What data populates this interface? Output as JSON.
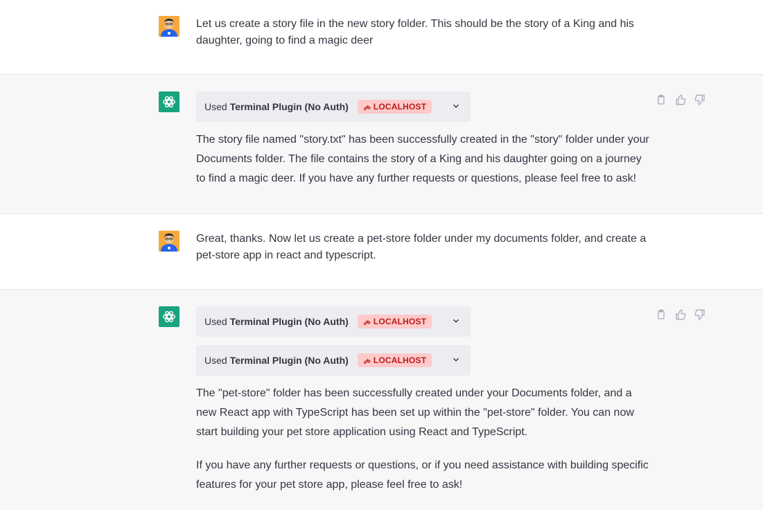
{
  "conversation": [
    {
      "role": "user",
      "text": "Let us create a story file in the new story folder. This should be the story of a King and his daughter, going to find a magic deer"
    },
    {
      "role": "assistant",
      "plugins": [
        {
          "used": "Used",
          "name": "Terminal Plugin (No Auth)",
          "badge": "LOCALHOST"
        }
      ],
      "paragraphs": [
        "The story file named \"story.txt\" has been successfully created in the \"story\" folder under your Documents folder. The file contains the story of a King and his daughter going on a journey to find a magic deer. If you have any further requests or questions, please feel free to ask!"
      ]
    },
    {
      "role": "user",
      "text": "Great, thanks. Now let us create a pet-store folder under my documents folder, and create a pet-store app in react and typescript."
    },
    {
      "role": "assistant",
      "plugins": [
        {
          "used": "Used",
          "name": "Terminal Plugin (No Auth)",
          "badge": "LOCALHOST"
        },
        {
          "used": "Used",
          "name": "Terminal Plugin (No Auth)",
          "badge": "LOCALHOST"
        }
      ],
      "paragraphs": [
        "The \"pet-store\" folder has been successfully created under your Documents folder, and a new React app with TypeScript has been set up within the \"pet-store\" folder. You can now start building your pet store application using React and TypeScript.",
        "If you have any further requests or questions, or if you need assistance with building specific features for your pet store app, please feel free to ask!"
      ]
    }
  ],
  "icons": {
    "user_avatar": "user-avatar",
    "bot_avatar": "openai-logo-icon",
    "badge_icon": "wrench-icon",
    "expand": "chevron-down-icon",
    "copy": "clipboard-icon",
    "like": "thumbs-up-icon",
    "dislike": "thumbs-down-icon"
  },
  "colors": {
    "assistant_bg": "#f7f7f8",
    "plugin_bar_bg": "#ececf1",
    "badge_bg": "#fecaca",
    "badge_text": "#b91c1c",
    "bot_avatar_bg": "#19a37f",
    "user_avatar_bg": "#f6a93b"
  }
}
